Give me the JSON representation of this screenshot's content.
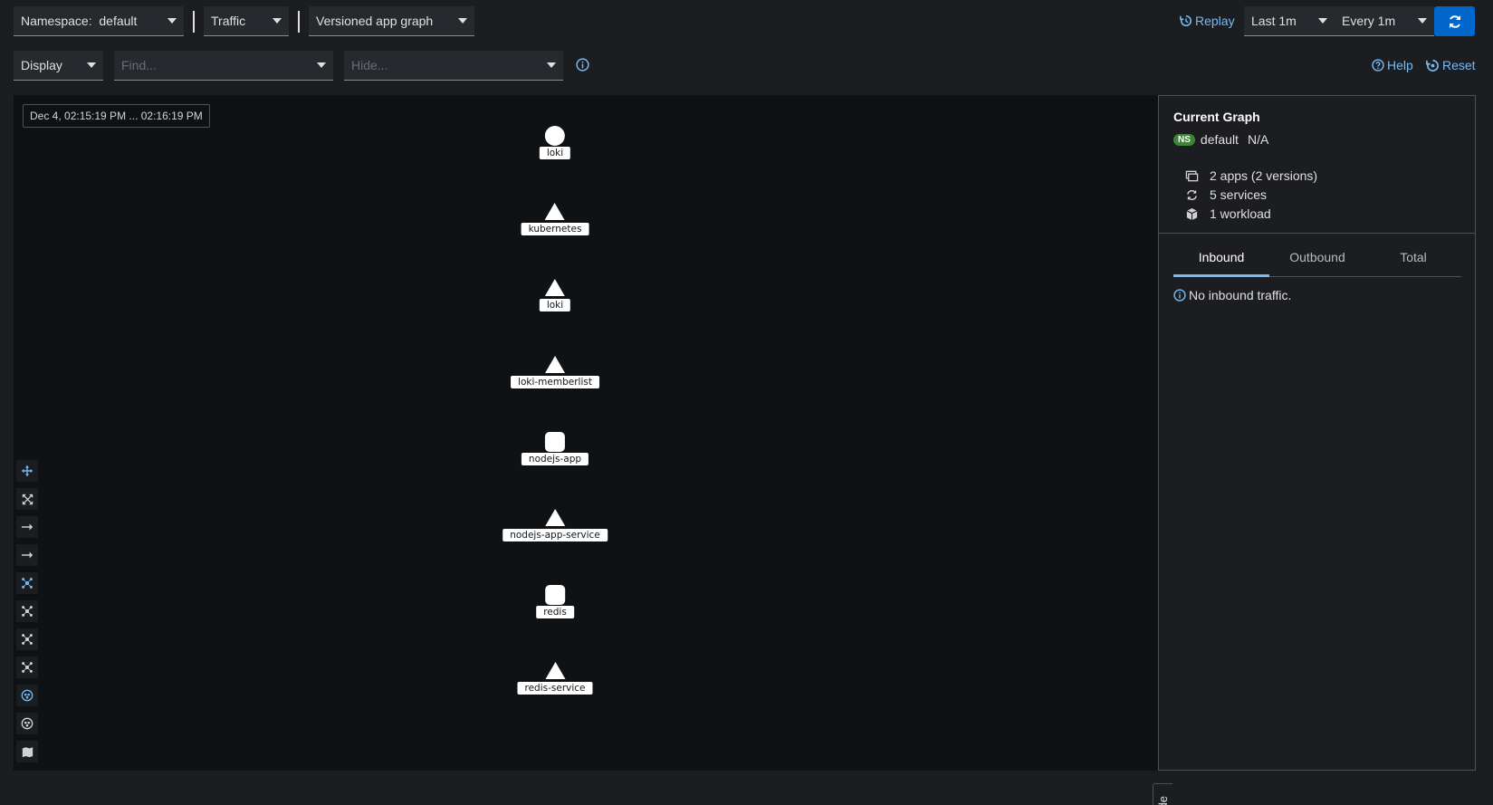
{
  "toolbar": {
    "namespace_label": "Namespace:",
    "namespace_value": "default",
    "traffic_label": "Traffic",
    "graph_type_label": "Versioned app graph",
    "replay_label": "Replay",
    "duration_label": "Last 1m",
    "refresh_interval_label": "Every 1m",
    "display_label": "Display",
    "find_placeholder": "Find...",
    "hide_placeholder": "Hide...",
    "help_label": "Help",
    "reset_label": "Reset"
  },
  "graph": {
    "timestamp": "Dec 4, 02:15:19 PM ... 02:16:19 PM",
    "hide_label": "Hide",
    "nodes": [
      {
        "label": "loki",
        "shape": "circle"
      },
      {
        "label": "kubernetes",
        "shape": "triangle"
      },
      {
        "label": "loki",
        "shape": "triangle"
      },
      {
        "label": "loki-memberlist",
        "shape": "triangle"
      },
      {
        "label": "nodejs-app",
        "shape": "square"
      },
      {
        "label": "nodejs-app-service",
        "shape": "triangle"
      },
      {
        "label": "redis",
        "shape": "square"
      },
      {
        "label": "redis-service",
        "shape": "triangle"
      }
    ]
  },
  "side_panel": {
    "title": "Current Graph",
    "ns_badge": "NS",
    "namespace": "default",
    "namespace_extra": "N/A",
    "apps": "2 apps (2 versions)",
    "services": "5 services",
    "workloads": "1 workload",
    "tabs": [
      "Inbound",
      "Outbound",
      "Total"
    ],
    "active_tab": "Inbound",
    "empty_message": "No inbound traffic."
  },
  "colors": {
    "accent": "#73bcf7",
    "primary_button": "#0066cc",
    "ns_badge": "#3e8635"
  }
}
